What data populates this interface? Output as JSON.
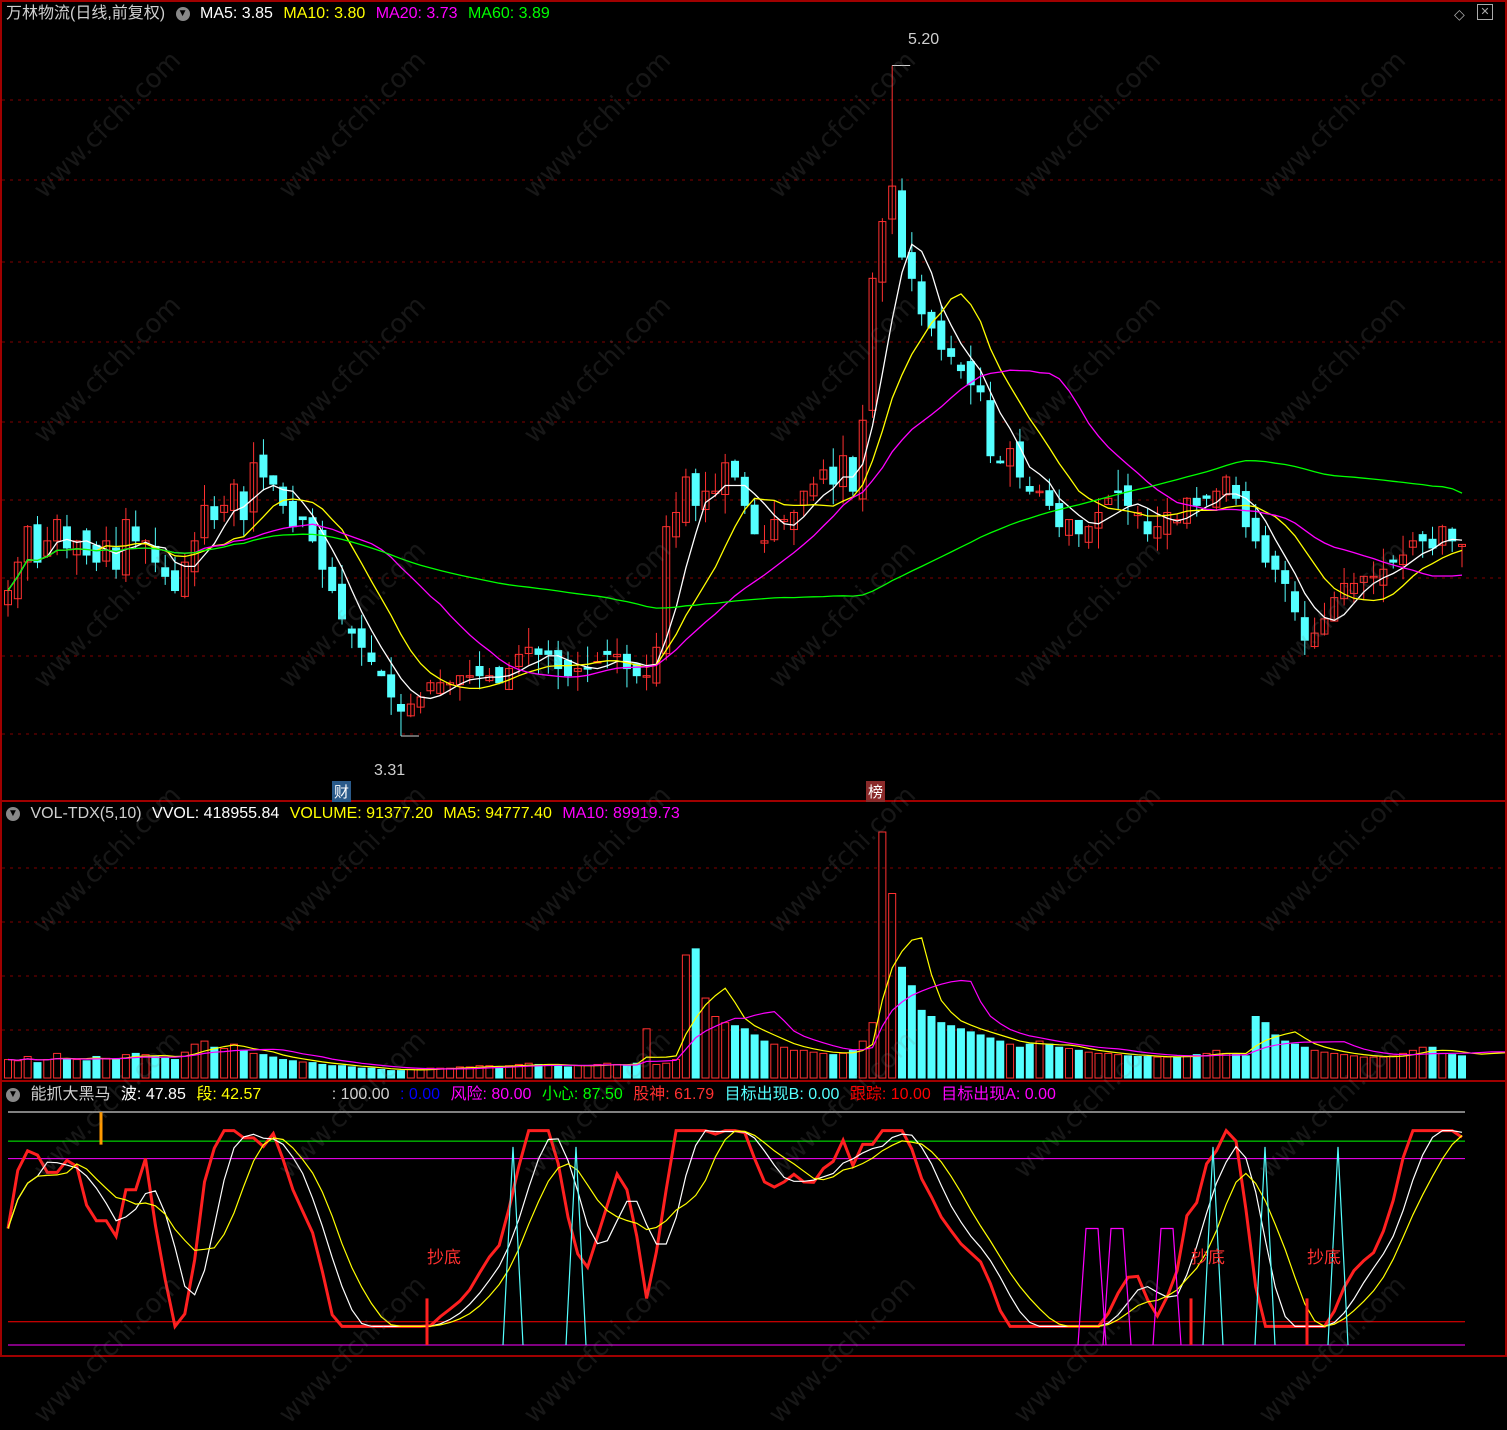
{
  "main_panel": {
    "title": "万林物流(日线,前复权)",
    "ma5_label": "MA5: 3.85",
    "ma10_label": "MA10: 3.80",
    "ma20_label": "MA20: 3.73",
    "ma60_label": "MA60: 3.89",
    "high_mark": "5.20",
    "low_mark": "3.31",
    "badge_left": "财",
    "badge_right": "榜"
  },
  "vol_panel": {
    "title": "VOL-TDX(5,10)",
    "vvol_label": "VVOL: 418955.84",
    "volume_label": "VOLUME: 91377.20",
    "ma5_label": "MA5: 94777.40",
    "ma10_label": "MA10: 89919.73"
  },
  "ind_panel": {
    "title": "能抓大黑马",
    "wave_label": "波: 47.85",
    "seg_label": "段: 42.57",
    "level_label": ": 100.00",
    "zero_label": ": 0.00",
    "risk_label": "风险: 80.00",
    "caution_label": "小心: 87.50",
    "stock_god_label": "股神: 61.79",
    "target_b_label": "目标出现B: 0.00",
    "track_label": "跟踪: 10.00",
    "target_a_label": "目标出现A: 0.00",
    "signal_labels": [
      "抄底",
      "抄底",
      "抄底"
    ]
  },
  "watermark": "www.cfchi.com",
  "colors": {
    "up": "#ff3030",
    "down": "#54ffff",
    "ma5": "#ffffff",
    "ma10": "#ffff00",
    "ma20": "#ff00ff",
    "ma60": "#00ff00",
    "grid": "#800000",
    "bg": "#000000"
  },
  "chart_data": [
    {
      "type": "candlestick",
      "title": "万林物流(日线,前复权)",
      "ylim": [
        3.2,
        5.3
      ],
      "annotations": [
        {
          "label": "5.20",
          "value": 5.2
        },
        {
          "label": "3.31",
          "value": 3.31
        }
      ],
      "close": [
        3.72,
        3.8,
        3.9,
        3.8,
        3.86,
        3.92,
        3.84,
        3.86,
        3.82,
        3.8,
        3.86,
        3.78,
        3.92,
        3.86,
        3.86,
        3.8,
        3.76,
        3.72,
        3.8,
        3.86,
        3.96,
        3.92,
        3.96,
        4.02,
        3.92,
        4.08,
        4.04,
        4.02,
        3.96,
        3.9,
        3.92,
        3.86,
        3.78,
        3.72,
        3.64,
        3.6,
        3.56,
        3.52,
        3.48,
        3.42,
        3.38,
        3.4,
        3.42,
        3.46,
        3.46,
        3.46,
        3.48,
        3.48,
        3.48,
        3.48,
        3.46,
        3.5,
        3.54,
        3.56,
        3.54,
        3.54,
        3.5,
        3.48,
        3.5,
        3.5,
        3.52,
        3.54,
        3.54,
        3.5,
        3.48,
        3.48,
        3.56,
        3.9,
        3.94,
        4.04,
        3.96,
        4.0,
        4.0,
        4.08,
        4.04,
        3.96,
        3.88,
        3.86,
        3.92,
        3.92,
        3.94,
        4.0,
        4.02,
        4.06,
        4.02,
        4.1,
        4.0,
        4.2,
        4.6,
        4.76,
        4.86,
        4.66,
        4.6,
        4.5,
        4.46,
        4.4,
        4.38,
        4.34,
        4.3,
        4.28,
        4.1,
        4.08,
        4.12,
        4.04,
        4.0,
        4.0,
        3.96,
        3.9,
        3.92,
        3.88,
        3.9,
        3.94,
        3.98,
        4.0,
        3.96,
        3.94,
        3.88,
        3.9,
        3.94,
        3.92,
        3.98,
        3.96,
        3.98,
        4.0,
        4.04,
        3.98,
        3.9,
        3.86,
        3.8,
        3.78,
        3.74,
        3.66,
        3.58,
        3.6,
        3.64,
        3.7,
        3.74,
        3.74,
        3.76,
        3.76,
        3.78,
        3.8,
        3.82,
        3.86,
        3.86,
        3.84,
        3.9,
        3.86,
        3.85
      ],
      "ma5_last": 3.85,
      "ma10_last": 3.8,
      "ma20_last": 3.73,
      "ma60_last": 3.89
    },
    {
      "type": "bar",
      "title": "VOL-TDX(5,10)",
      "values": [
        30,
        28,
        35,
        25,
        30,
        40,
        30,
        30,
        28,
        35,
        32,
        30,
        38,
        40,
        38,
        35,
        32,
        30,
        42,
        55,
        60,
        50,
        48,
        55,
        45,
        40,
        38,
        34,
        30,
        28,
        26,
        25,
        22,
        20,
        20,
        18,
        16,
        16,
        14,
        12,
        12,
        14,
        14,
        16,
        16,
        16,
        18,
        18,
        20,
        20,
        18,
        20,
        22,
        24,
        22,
        22,
        20,
        18,
        20,
        20,
        22,
        24,
        22,
        20,
        24,
        80,
        22,
        24,
        30,
        200,
        210,
        130,
        100,
        90,
        85,
        80,
        70,
        60,
        55,
        50,
        45,
        45,
        42,
        40,
        38,
        40,
        45,
        60,
        90,
        400,
        300,
        180,
        150,
        110,
        100,
        90,
        85,
        80,
        75,
        70,
        65,
        60,
        55,
        50,
        55,
        60,
        55,
        50,
        48,
        45,
        42,
        40,
        40,
        38,
        36,
        35,
        35,
        34,
        34,
        34,
        36,
        38,
        40,
        45,
        40,
        38,
        36,
        100,
        90,
        70,
        60,
        55,
        50,
        45,
        42,
        40,
        38,
        36,
        34,
        34,
        34,
        36,
        40,
        45,
        50,
        50,
        40,
        38,
        36,
        38,
        42,
        45,
        42,
        40,
        40
      ],
      "vvol": 418955.84,
      "volume": 91377.2,
      "ma5": 94777.4,
      "ma10": 89919.73
    },
    {
      "type": "line",
      "title": "能抓大黑马",
      "series": [
        {
          "name": "波",
          "last": 47.85
        },
        {
          "name": "段",
          "last": 42.57
        },
        {
          "name": "风险",
          "last": 80.0
        },
        {
          "name": "小心",
          "last": 87.5
        },
        {
          "name": "股神",
          "last": 61.79
        },
        {
          "name": "目标出现B",
          "last": 0.0
        },
        {
          "name": "跟踪",
          "last": 10.0
        },
        {
          "name": "目标出现A",
          "last": 0.0
        }
      ]
    }
  ]
}
